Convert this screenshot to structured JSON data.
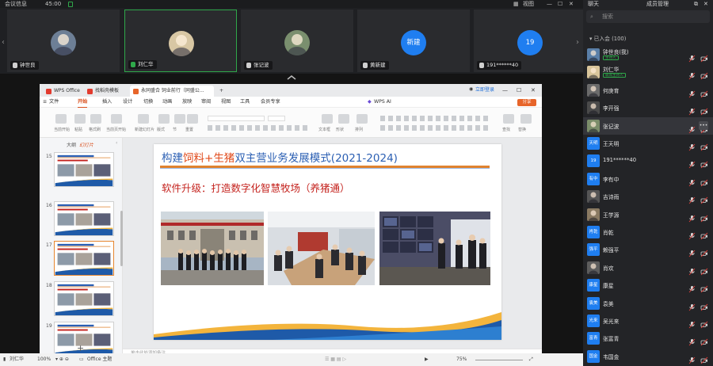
{
  "meeting": {
    "info_label": "会议信息",
    "timer": "45:00",
    "view_label": "视图"
  },
  "participants_strip": [
    {
      "name": "钟世良",
      "kind": "photo",
      "bg": "#6d7f96"
    },
    {
      "name": "刘仁华",
      "kind": "photo",
      "bg": "#d8c7a4",
      "active": true
    },
    {
      "name": "张记波",
      "kind": "photo",
      "bg": "#7a8f6e"
    },
    {
      "name": "黄新建",
      "kind": "text",
      "avatar_text": "新建"
    },
    {
      "name": "191******40",
      "kind": "text",
      "avatar_text": "19"
    }
  ],
  "wps": {
    "tabs": [
      {
        "label": "WPS Office",
        "color": "#e23b2e"
      },
      {
        "label": "找稻壳模板",
        "color": "#e23b2e"
      },
      {
        "label": "永同盛合 饲业前行（同盛公...",
        "color": "#e7652a"
      }
    ],
    "new_tab": "+",
    "login": "立即登录",
    "menu": [
      "文件",
      "开始",
      "插入",
      "设计",
      "切换",
      "动画",
      "放映",
      "审阅",
      "视图",
      "工具",
      "会员专享",
      "WPS AI"
    ],
    "share": "分享",
    "ribbon_labels": [
      "当前开始",
      "粘贴",
      "格式刷",
      "当前页开始",
      "新建幻灯片",
      "版式",
      "节",
      "重置",
      "文本框",
      "形状",
      "排列",
      "查找",
      "替换"
    ],
    "left_tabs": {
      "outline": "大纲",
      "slides": "幻灯片"
    },
    "slide_numbers": [
      "15",
      "16",
      "17",
      "18",
      "19"
    ],
    "notes_placeholder": "单击此处添加备注",
    "slide": {
      "title_pre": "构建",
      "title_hl1": "饲料",
      "title_plus": "+",
      "title_hl2": "生猪",
      "title_post": "双主营业务发展模式(2021-2024)",
      "subtitle": "软件升级：打造数字化智慧牧场（养猪通）"
    },
    "status": {
      "user": "刘仁华",
      "zoom": "100%",
      "theme": "Office 主题",
      "zoom_pct": "75%"
    }
  },
  "panel": {
    "tab_chat": "聊天",
    "tab_members": "成员管理",
    "search_placeholder": "搜索",
    "joined": "已入会 (100)",
    "members": [
      {
        "name": "钟世良(我)",
        "role": "主持人",
        "av": "photo",
        "color": "#5a7fa8"
      },
      {
        "name": "刘仁华",
        "role": "联席主持人",
        "av": "photo",
        "color": "#d9c59b"
      },
      {
        "name": "何庚育",
        "av": "photo",
        "color": "#6b6b6b"
      },
      {
        "name": "李开强",
        "av": "photo",
        "color": "#4a4a4a"
      },
      {
        "name": "张记波",
        "av": "photo",
        "color": "#7b8d6a",
        "hover": true
      },
      {
        "name": "王天明",
        "av": "text",
        "av_text": "天明",
        "color": "#1f7ef0"
      },
      {
        "name": "191******40",
        "av": "text",
        "av_text": "19",
        "color": "#1f7ef0"
      },
      {
        "name": "李有中",
        "av": "text",
        "av_text": "有中",
        "color": "#1f7ef0"
      },
      {
        "name": "吉诗雨",
        "av": "photo",
        "color": "#555555"
      },
      {
        "name": "王学源",
        "av": "photo",
        "color": "#8a7a62"
      },
      {
        "name": "肖乾",
        "av": "text",
        "av_text": "肖乾",
        "color": "#1f7ef0"
      },
      {
        "name": "赖强平",
        "av": "text",
        "av_text": "强平",
        "color": "#1f7ef0"
      },
      {
        "name": "肖欢",
        "av": "photo",
        "color": "#5d5d5d"
      },
      {
        "name": "康星",
        "av": "text",
        "av_text": "康星",
        "color": "#1f7ef0"
      },
      {
        "name": "袁美",
        "av": "text",
        "av_text": "袁美",
        "color": "#1f7ef0"
      },
      {
        "name": "吴光来",
        "av": "text",
        "av_text": "光来",
        "color": "#1f7ef0"
      },
      {
        "name": "张富青",
        "av": "text",
        "av_text": "富青",
        "color": "#1f7ef0"
      },
      {
        "name": "韦国金",
        "av": "text",
        "av_text": "国金",
        "color": "#1f7ef0"
      }
    ]
  }
}
